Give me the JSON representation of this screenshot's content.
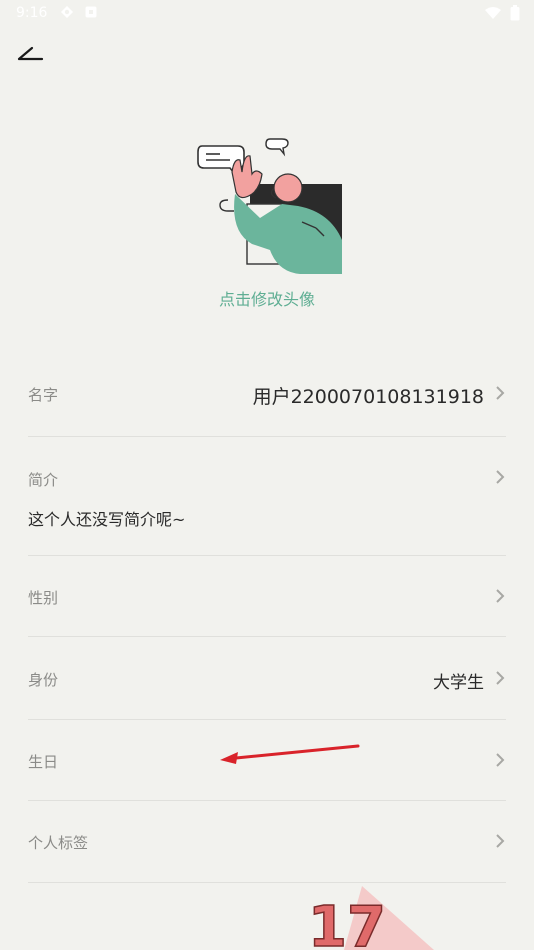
{
  "status_bar": {
    "time": "9:16",
    "icons": [
      "location-icon",
      "notification-icon",
      "wifi-icon",
      "battery-icon"
    ]
  },
  "header": {
    "back_icon": "back-arrow-icon"
  },
  "avatar": {
    "caption": "点击修改头像"
  },
  "profile": {
    "rows": [
      {
        "label": "名字",
        "value": "用户2200070108131918"
      },
      {
        "label": "简介",
        "value": "这个人还没写简介呢~"
      },
      {
        "label": "性别",
        "value": ""
      },
      {
        "label": "身份",
        "value": "大学生"
      },
      {
        "label": "生日",
        "value": ""
      },
      {
        "label": "个人标签",
        "value": ""
      }
    ]
  },
  "colors": {
    "background": "#f2f2ee",
    "accent": "#5fae93",
    "annotation_arrow": "#d9232a",
    "divider": "#e0e0dc"
  },
  "watermark": {
    "text": "17"
  }
}
